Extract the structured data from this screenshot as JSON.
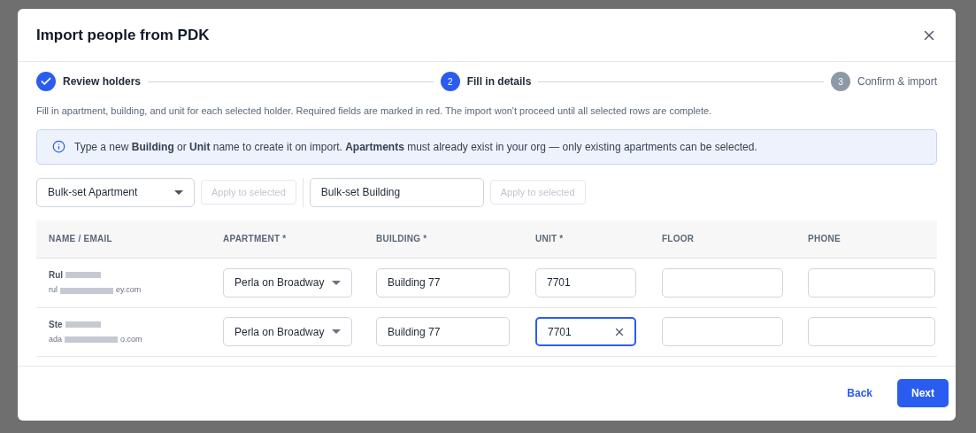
{
  "dialog": {
    "title": "Import people from PDK"
  },
  "steps": [
    {
      "label": "Review holders",
      "done": true,
      "reached": true
    },
    {
      "number": "2",
      "label": "Fill in details",
      "done": false,
      "reached": true
    },
    {
      "number": "3",
      "label": "Confirm & import",
      "done": false,
      "reached": false
    }
  ],
  "description": "Fill in apartment, building, and unit for each selected holder. Required fields are marked in red. The import won't proceed until all selected rows are complete.",
  "info": "Type a new **Building** or **Unit** name to create it on import. **Apartments** must already exist in your org — only existing apartments can be selected.",
  "bulk": {
    "apartment": {
      "placeholder": "Bulk-set Apartment"
    },
    "apartment_apply": {
      "label": "Apply to selected",
      "disabled": true
    },
    "building": {
      "placeholder": "Bulk-set Building"
    },
    "building_apply": {
      "label": "Apply to selected",
      "disabled": true
    }
  },
  "table": {
    "columns": [
      "NAME / EMAIL",
      "APARTMENT *",
      "BUILDING *",
      "UNIT *",
      "FLOOR",
      "PHONE"
    ],
    "rows": [
      {
        "name": "Rul",
        "email_start": "rul",
        "email_end": "ey.com",
        "apartment": "Perla on Broadway",
        "building": "Building 77",
        "unit": "7701",
        "unit_focused": false
      },
      {
        "name": "Ste",
        "email_start": "ada",
        "email_end": "o.com",
        "apartment": "Perla on Broadway",
        "building": "Building 77",
        "unit": "7701",
        "unit_focused": true
      }
    ]
  },
  "footer": {
    "back": "Back",
    "next": "Next"
  }
}
